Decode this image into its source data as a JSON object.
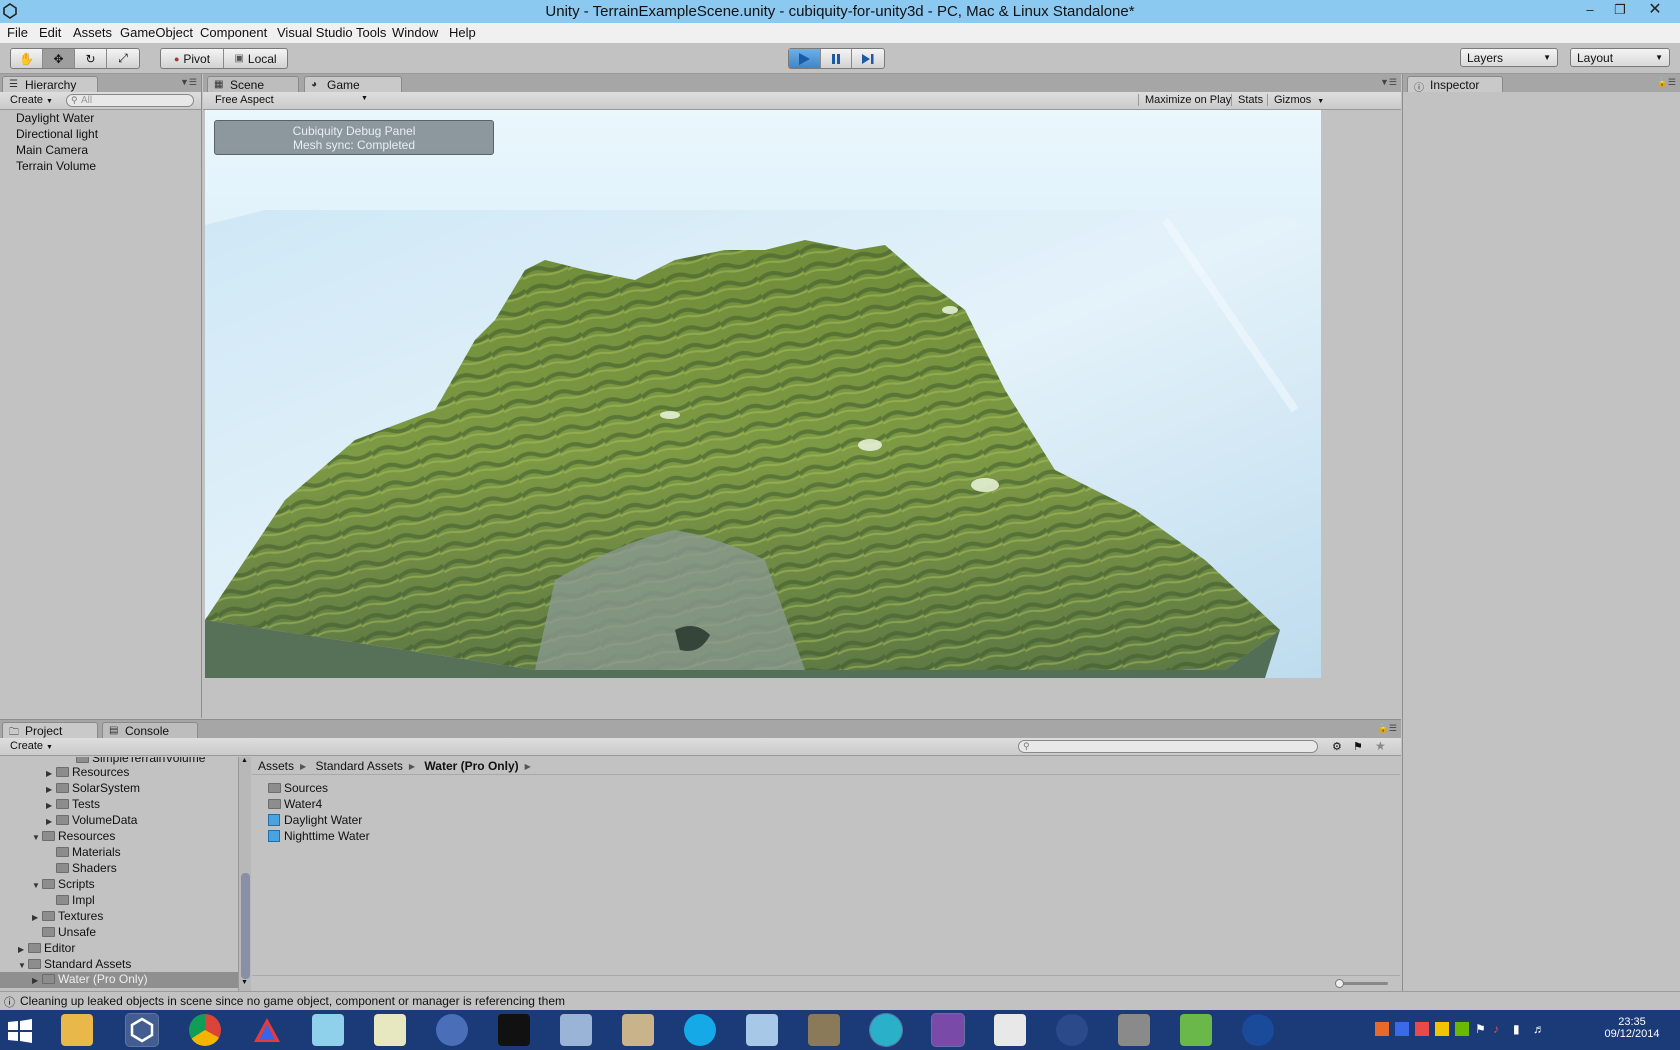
{
  "window": {
    "title": "Unity - TerrainExampleScene.unity - cubiquity-for-unity3d - PC, Mac & Linux Standalone*"
  },
  "menu": [
    "File",
    "Edit",
    "Assets",
    "GameObject",
    "Component",
    "Visual Studio Tools",
    "Window",
    "Help"
  ],
  "toolbar": {
    "pivot": "Pivot",
    "local": "Local",
    "layers": "Layers",
    "layout": "Layout",
    "play_state": "playing"
  },
  "hierarchy": {
    "tab": "Hierarchy",
    "create": "Create",
    "search_placeholder": "All",
    "items": [
      "Daylight Water",
      "Directional light",
      "Main Camera",
      "Terrain Volume"
    ]
  },
  "scene_tab": "Scene",
  "game": {
    "tab": "Game",
    "aspect": "Free Aspect",
    "maximize": "Maximize on Play",
    "stats": "Stats",
    "gizmos": "Gizmos",
    "debug_title": "Cubiquity Debug Panel",
    "debug_status": "Mesh sync: Completed"
  },
  "inspector": {
    "tab": "Inspector"
  },
  "project": {
    "tab": "Project",
    "console_tab": "Console",
    "create": "Create",
    "tree": [
      {
        "label": "SimpleTerrainVolume",
        "depth": 3,
        "arrow": ""
      },
      {
        "label": "Resources",
        "depth": 3,
        "arrow": "▶"
      },
      {
        "label": "SolarSystem",
        "depth": 3,
        "arrow": "▶"
      },
      {
        "label": "Tests",
        "depth": 3,
        "arrow": "▶"
      },
      {
        "label": "VolumeData",
        "depth": 3,
        "arrow": "▶"
      },
      {
        "label": "Resources",
        "depth": 2,
        "arrow": "▼"
      },
      {
        "label": "Materials",
        "depth": 3,
        "arrow": ""
      },
      {
        "label": "Shaders",
        "depth": 3,
        "arrow": ""
      },
      {
        "label": "Scripts",
        "depth": 2,
        "arrow": "▼"
      },
      {
        "label": "Impl",
        "depth": 3,
        "arrow": ""
      },
      {
        "label": "Textures",
        "depth": 2,
        "arrow": "▶"
      },
      {
        "label": "Unsafe",
        "depth": 2,
        "arrow": ""
      },
      {
        "label": "Editor",
        "depth": 1,
        "arrow": "▶"
      },
      {
        "label": "Standard Assets",
        "depth": 1,
        "arrow": "▼"
      },
      {
        "label": "Water (Pro Only)",
        "depth": 2,
        "arrow": "▶"
      }
    ],
    "breadcrumb": [
      "Assets",
      "Standard Assets",
      "Water (Pro Only)"
    ],
    "assets": [
      {
        "label": "Sources",
        "kind": "folder"
      },
      {
        "label": "Water4",
        "kind": "folder"
      },
      {
        "label": "Daylight Water",
        "kind": "prefab"
      },
      {
        "label": "Nighttime Water",
        "kind": "prefab"
      }
    ]
  },
  "status": {
    "message": "Cleaning up leaked objects in scene since no game object, component or manager is referencing them"
  },
  "taskbar": {
    "time": "23:35",
    "date": "09/12/2014"
  }
}
